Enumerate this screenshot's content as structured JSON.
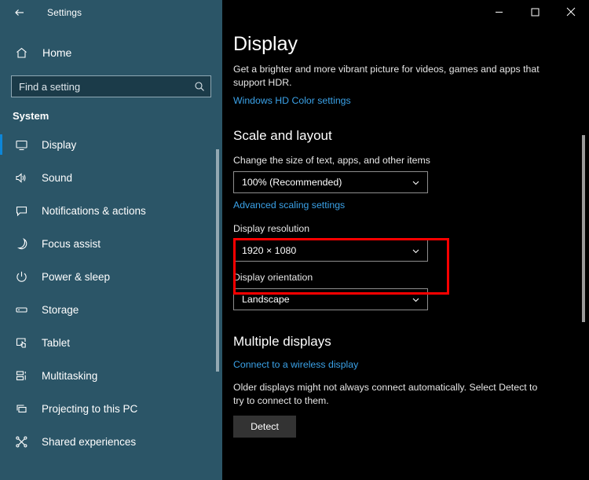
{
  "sidebar": {
    "back_icon": "back-arrow-icon",
    "title": "Settings",
    "home": {
      "label": "Home",
      "icon": "home-icon"
    },
    "search": {
      "placeholder": "Find a setting",
      "value": "",
      "icon": "search-icon"
    },
    "section_header": "System",
    "accent_color": "#0d86d8",
    "background_color": "#2b5567",
    "items": [
      {
        "label": "Display",
        "icon": "monitor-icon",
        "selected": true
      },
      {
        "label": "Sound",
        "icon": "speaker-icon",
        "selected": false
      },
      {
        "label": "Notifications & actions",
        "icon": "notification-icon",
        "selected": false
      },
      {
        "label": "Focus assist",
        "icon": "moon-icon",
        "selected": false
      },
      {
        "label": "Power & sleep",
        "icon": "power-icon",
        "selected": false
      },
      {
        "label": "Storage",
        "icon": "drive-icon",
        "selected": false
      },
      {
        "label": "Tablet",
        "icon": "tablet-icon",
        "selected": false
      },
      {
        "label": "Multitasking",
        "icon": "multitasking-icon",
        "selected": false
      },
      {
        "label": "Projecting to this PC",
        "icon": "projecting-icon",
        "selected": false
      },
      {
        "label": "Shared experiences",
        "icon": "share-nodes-icon",
        "selected": false
      }
    ]
  },
  "window_controls": {
    "minimize": "─",
    "maximize": "□",
    "close": "✕"
  },
  "main": {
    "title": "Display",
    "description": "Get a brighter and more vibrant picture for videos, games and apps that support HDR.",
    "hd_color_link": "Windows HD Color settings",
    "scale_section": {
      "heading": "Scale and layout",
      "scale_label": "Change the size of text, apps, and other items",
      "scale_value": "100% (Recommended)",
      "advanced_link": "Advanced scaling settings",
      "resolution_label": "Display resolution",
      "resolution_value": "1920 × 1080",
      "orientation_label": "Display orientation",
      "orientation_value": "Landscape"
    },
    "multiple_displays": {
      "heading": "Multiple displays",
      "wireless_link": "Connect to a wireless display",
      "note": "Older displays might not always connect automatically. Select Detect to try to connect to them.",
      "detect_label": "Detect"
    },
    "highlight_color": "#ff0000"
  }
}
